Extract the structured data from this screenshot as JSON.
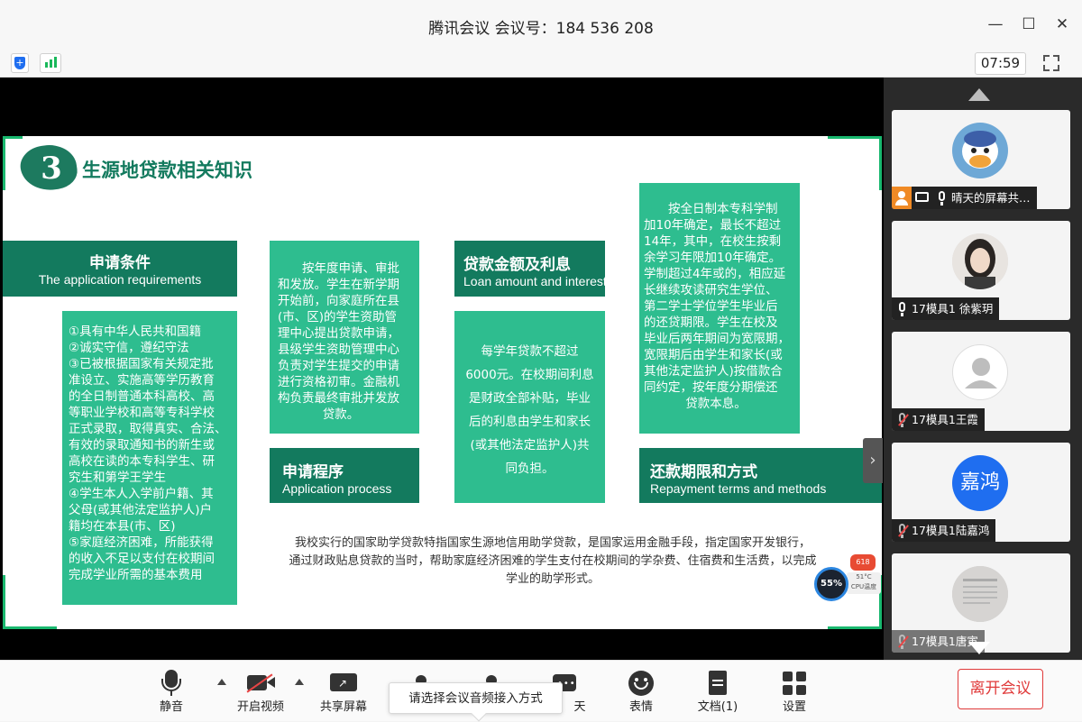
{
  "window": {
    "title": "腾讯会议 会议号：184 536 208",
    "timer": "07:59"
  },
  "slide": {
    "number": "3",
    "title": "生源地贷款相关知识",
    "conditions_header": {
      "zh": "申请条件",
      "en": "The application requirements"
    },
    "conditions_lines": [
      "①具有中华人民共和国籍",
      "②诚实守信，遵纪守法",
      "③已被根据国家有关规定批",
      "准设立、实施高等学历教育",
      "的全日制普通本科高校、高",
      "等职业学校和高等专科学校",
      "正式录取，取得真实、合法、",
      "有效的录取通知书的新生或",
      "高校在读的本专科学生、研",
      "究生和第学王学生",
      "④学生本人入学前户籍、其",
      "父母(或其他法定监护人)户",
      "籍均在本县(市、区)",
      "⑤家庭经济困难，所能获得",
      "的收入不足以支付在校期间",
      "完成学业所需的基本费用"
    ],
    "process_lines": [
      "　　按年度申请、审批",
      "和发放。学生在新学期",
      "开始前，向家庭所在县",
      "(市、区)的学生资助管",
      "理中心提出贷款申请，",
      "县级学生资助管理中心",
      "负责对学生提交的申请",
      "进行资格初审。金融机",
      "构负责最终审批并发放",
      "贷款。"
    ],
    "process_header": {
      "zh": "申请程序",
      "en": "Application process"
    },
    "amount_header": {
      "zh": "贷款金额及利息",
      "en": "Loan amount and interest"
    },
    "amount_lines": [
      "每学年贷款不超过",
      "6000元。在校期间利息",
      "是财政全部补贴，毕业",
      "后的利息由学生和家长",
      "(或其他法定监护人)共",
      "同负担。"
    ],
    "repay_lines": [
      "　　按全日制本专科学制",
      "加10年确定，最长不超过",
      "14年，其中，在校生按剩",
      "余学习年限加10年确定。",
      "学制超过4年或的，相应延",
      "长继续攻读研究生学位、",
      "第二学士学位学生毕业后",
      "的还贷期限。学生在校及",
      "毕业后两年期间为宽限期，",
      "宽限期后由学生和家长(或",
      "其他法定监护人)按借款合",
      "同约定，按年度分期偿还",
      "贷款本息。"
    ],
    "repay_header": {
      "zh": "还款期限和方式",
      "en": "Repayment terms and methods"
    },
    "bottom_lines": [
      "我校实行的国家助学贷款特指国家生源地信用助学贷款，是国家运用金融手段，指定国家开发银行，",
      "通过财政贴息贷款的当时，帮助家庭经济困难的学生支付在校期间的学杂费、住宿费和生活费，以完成",
      "学业的助学形式。"
    ]
  },
  "cpu_widget": {
    "usage": "55%",
    "temp": "51°C",
    "label": "CPU温度",
    "badge": "618"
  },
  "participants": [
    {
      "name": "晴天的屏幕共…",
      "avatar": "duck-avatar"
    },
    {
      "name": "17模具1 徐紫玥",
      "avatar": "photo-avatar"
    },
    {
      "name": "17模具1王霞",
      "avatar": "default-avatar"
    },
    {
      "name": "17模具1陆嘉鸿",
      "avatar_text": "嘉鸿",
      "avatar_color": "#1f6ef0"
    },
    {
      "name": "17模具1唐寅",
      "avatar": "document-avatar"
    }
  ],
  "toolbar": {
    "mute": "静音",
    "video": "开启视频",
    "share": "共享屏幕",
    "chat_partial": "天",
    "emoji": "表情",
    "docs": "文档(1)",
    "settings": "设置",
    "leave": "离开会议",
    "tooltip": "请选择会议音频接入方式"
  },
  "colors": {
    "accent_green": "#137a5e",
    "box_green": "#2ebd8f",
    "leave_red": "#e03a3a",
    "brand_blue": "#1f6ef0"
  }
}
